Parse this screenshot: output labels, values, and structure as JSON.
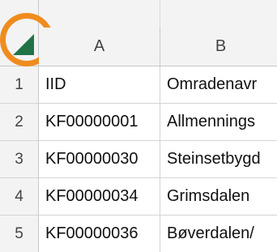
{
  "columns": [
    {
      "letter": "A"
    },
    {
      "letter": "B"
    }
  ],
  "rows": [
    {
      "num": "1",
      "a": "IID",
      "b": "Omradenavr"
    },
    {
      "num": "2",
      "a": "KF00000001",
      "b": "Allmennings"
    },
    {
      "num": "3",
      "a": "KF00000030",
      "b": "Steinsetbygd"
    },
    {
      "num": "4",
      "a": "KF00000034",
      "b": "Grimsdalen"
    },
    {
      "num": "5",
      "a": "KF00000036",
      "b": "Bøverdalen/"
    }
  ],
  "accent_colors": {
    "select_all_triangle": "#217346",
    "highlight_ring": "#f08c1e"
  },
  "icons": {
    "select_all": "select-all-triangle-icon"
  }
}
